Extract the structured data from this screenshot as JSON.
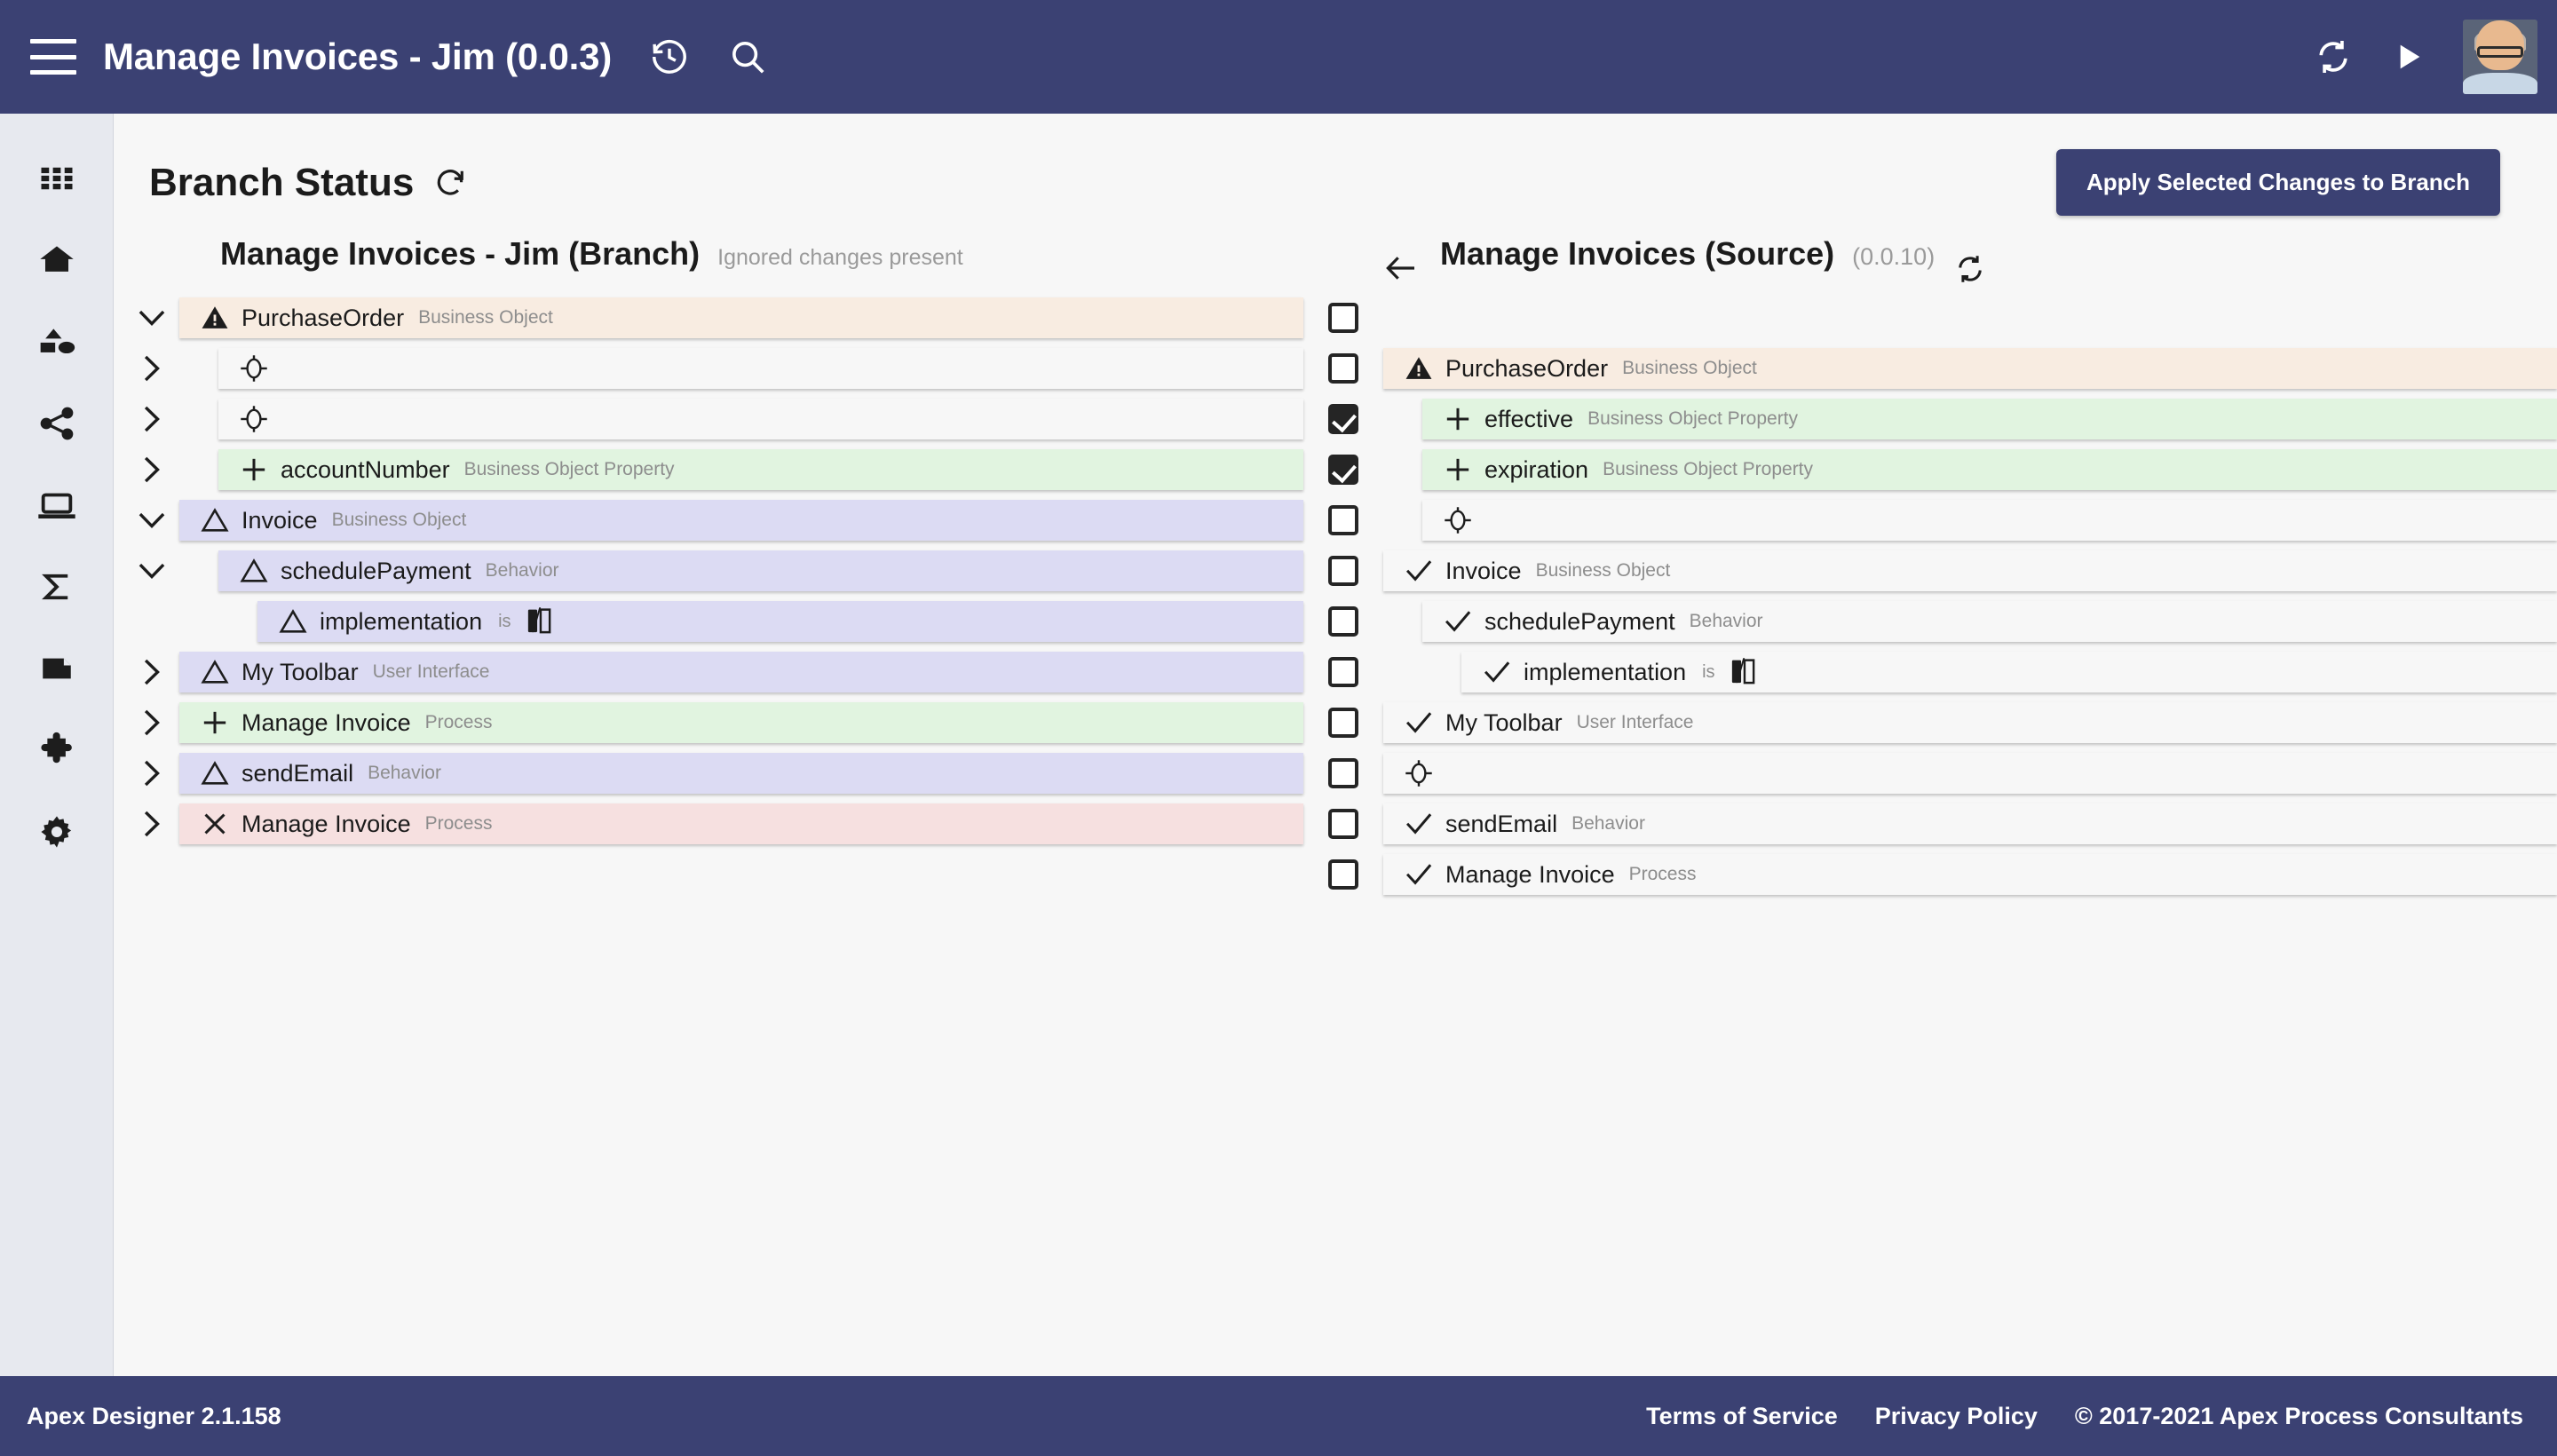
{
  "header": {
    "menu_icon": "hamburger-icon",
    "title": "Manage Invoices - Jim (0.0.3)",
    "history_icon": "history-icon",
    "search_icon": "search-icon",
    "sync_icon": "sync-icon",
    "run_icon": "play-icon",
    "avatar": "user-avatar"
  },
  "sidebar": {
    "items": [
      {
        "icon": "apps-grid-icon"
      },
      {
        "icon": "home-icon"
      },
      {
        "icon": "shapes-icon"
      },
      {
        "icon": "share-network-icon"
      },
      {
        "icon": "laptop-icon"
      },
      {
        "icon": "sigma-icon"
      },
      {
        "icon": "document-icon"
      },
      {
        "icon": "puzzle-piece-icon"
      },
      {
        "icon": "gear-icon"
      }
    ]
  },
  "page": {
    "title": "Branch Status",
    "refresh_icon": "refresh-icon",
    "apply_button": "Apply Selected Changes to Branch"
  },
  "branch_panel": {
    "title": "Manage Invoices - Jim (Branch)",
    "note": "Ignored changes present",
    "rows": [
      {
        "chevron": "chevron-down",
        "indent": 0,
        "status": "warning",
        "bg": "bg-warn",
        "icon": "warning-triangle-icon",
        "name": "PurchaseOrder",
        "type": "Business Object"
      },
      {
        "chevron": "chevron-right",
        "indent": 1,
        "status": "empty",
        "bg": "bg-none",
        "icon": "vertex-diamond-icon",
        "name": "",
        "type": ""
      },
      {
        "chevron": "chevron-right",
        "indent": 1,
        "status": "empty",
        "bg": "bg-none",
        "icon": "vertex-diamond-icon",
        "name": "",
        "type": ""
      },
      {
        "chevron": "chevron-right",
        "indent": 1,
        "status": "added",
        "bg": "bg-add",
        "icon": "plus-icon",
        "name": "accountNumber",
        "type": "Business Object Property"
      },
      {
        "chevron": "chevron-down",
        "indent": 0,
        "status": "changed",
        "bg": "bg-chg",
        "icon": "change-triangle-icon",
        "name": "Invoice",
        "type": "Business Object"
      },
      {
        "chevron": "chevron-down",
        "indent": 1,
        "status": "changed",
        "bg": "bg-chg",
        "icon": "change-triangle-icon",
        "name": "schedulePayment",
        "type": "Behavior"
      },
      {
        "chevron": "none",
        "indent": 2,
        "status": "changed",
        "bg": "bg-chg",
        "icon": "change-triangle-icon",
        "name": "implementation",
        "type": "",
        "is_label": "is",
        "diff_icon": "compare-diff-icon"
      },
      {
        "chevron": "chevron-right",
        "indent": 0,
        "status": "changed",
        "bg": "bg-chg",
        "icon": "change-triangle-icon",
        "name": "My Toolbar",
        "type": "User Interface"
      },
      {
        "chevron": "chevron-right",
        "indent": 0,
        "status": "added",
        "bg": "bg-add",
        "icon": "plus-icon",
        "name": "Manage Invoice",
        "type": "Process"
      },
      {
        "chevron": "chevron-right",
        "indent": 0,
        "status": "changed",
        "bg": "bg-chg",
        "icon": "change-triangle-icon",
        "name": "sendEmail",
        "type": "Behavior"
      },
      {
        "chevron": "chevron-right",
        "indent": 0,
        "status": "deleted",
        "bg": "bg-del",
        "icon": "x-icon",
        "name": "Manage Invoice",
        "type": "Process"
      }
    ]
  },
  "source_panel": {
    "back_icon": "arrow-left-icon",
    "title": "Manage Invoices (Source)",
    "version": "(0.0.10)",
    "sync_icon": "sync-icon",
    "checkboxes": [
      {
        "checked": false
      },
      {
        "checked": false
      },
      {
        "checked": true
      },
      {
        "checked": true
      },
      {
        "checked": false
      },
      {
        "checked": false
      },
      {
        "checked": false
      },
      {
        "checked": false
      },
      {
        "checked": false
      },
      {
        "checked": false
      },
      {
        "checked": false
      },
      {
        "checked": false
      }
    ],
    "rows": [
      {
        "indent": 0,
        "bg": "bg-warn",
        "icon": "warning-triangle-icon",
        "name": "PurchaseOrder",
        "type": "Business Object"
      },
      {
        "indent": 1,
        "bg": "bg-add",
        "icon": "plus-icon",
        "name": "effective",
        "type": "Business Object Property"
      },
      {
        "indent": 1,
        "bg": "bg-add",
        "icon": "plus-icon",
        "name": "expiration",
        "type": "Business Object Property"
      },
      {
        "indent": 1,
        "bg": "bg-none",
        "icon": "vertex-diamond-icon",
        "name": "",
        "type": ""
      },
      {
        "indent": 0,
        "bg": "bg-none",
        "icon": "check-icon",
        "name": "Invoice",
        "type": "Business Object"
      },
      {
        "indent": 1,
        "bg": "bg-none",
        "icon": "check-icon",
        "name": "schedulePayment",
        "type": "Behavior"
      },
      {
        "indent": 2,
        "bg": "bg-none",
        "icon": "check-icon",
        "name": "implementation",
        "type": "",
        "is_label": "is",
        "diff_icon": "compare-diff-icon"
      },
      {
        "indent": 0,
        "bg": "bg-none",
        "icon": "check-icon",
        "name": "My Toolbar",
        "type": "User Interface"
      },
      {
        "indent": 0,
        "bg": "bg-none",
        "icon": "vertex-diamond-icon",
        "name": "",
        "type": ""
      },
      {
        "indent": 0,
        "bg": "bg-none",
        "icon": "check-icon",
        "name": "sendEmail",
        "type": "Behavior"
      },
      {
        "indent": 0,
        "bg": "bg-none",
        "icon": "check-icon",
        "name": "Manage Invoice",
        "type": "Process"
      }
    ]
  },
  "footer": {
    "version": "Apex Designer 2.1.158",
    "terms": "Terms of Service",
    "privacy": "Privacy Policy",
    "copyright": "© 2017-2021 Apex Process Consultants"
  },
  "colors": {
    "brand": "#3b4173",
    "added": "#e1f4e0",
    "changed": "#dcdbf3",
    "deleted": "#f6e0e0",
    "warning": "#f8ece1"
  }
}
